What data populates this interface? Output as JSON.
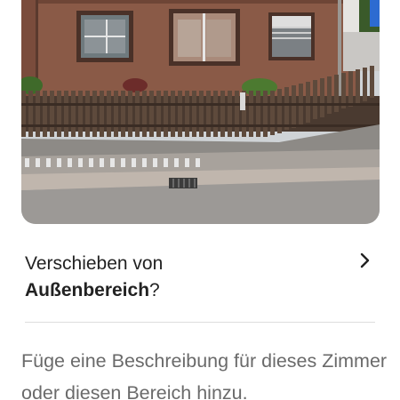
{
  "photo": {
    "alt_name": "listing-photo"
  },
  "move": {
    "prefix": "Verschieben von",
    "room": "Außenbereich",
    "suffix": "?",
    "icon": "chevron-right-icon"
  },
  "description": {
    "prompt": "Füge eine Beschreibung für dieses Zimmer oder diesen Bereich hinzu."
  },
  "colors": {
    "text_primary": "#222222",
    "text_secondary": "#6a6a6a",
    "divider": "#dddddd"
  }
}
